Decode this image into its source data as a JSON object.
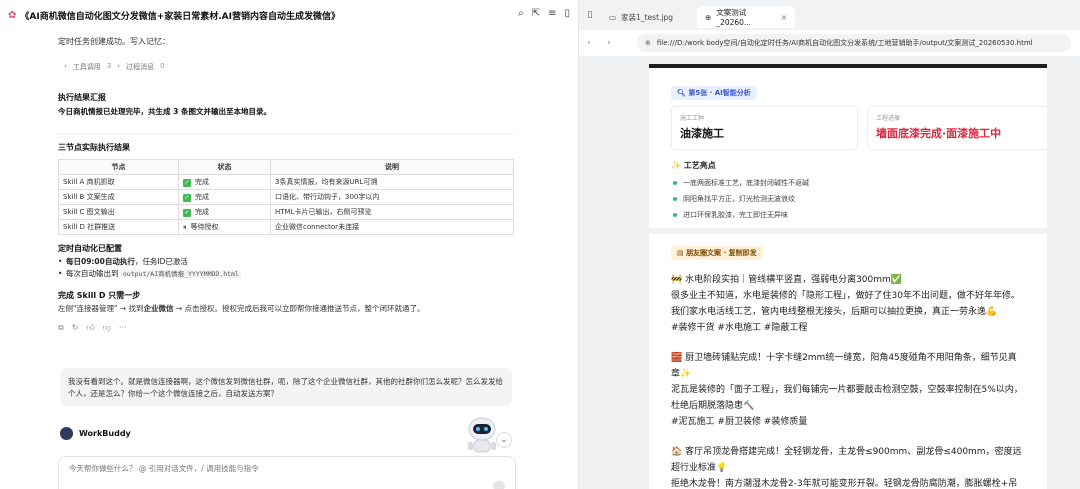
{
  "app": {
    "title": "《AI商机微信自动化图文分发微信+家装日常素材.AI营销内容自动生成发微信》",
    "tool_icons": [
      "search-icon",
      "export-icon",
      "menu-icon",
      "sidebar-icon"
    ]
  },
  "chat": {
    "intro": "定时任务创建成功。写入记忆：",
    "collapse": {
      "tools_label": "工具调用",
      "tools_count": "3",
      "process_label": "过程消息",
      "process_count": "0"
    },
    "summary_title": "执行结果汇报",
    "summary_text": "今日商机情报已处理完毕，共生成 3 条图文并输出至本地目录。",
    "table_title": "三节点实际执行结果",
    "table": {
      "headers": [
        "节点",
        "状态",
        "说明"
      ],
      "rows": [
        {
          "node": "Skill A 商机抓取",
          "status": "完成",
          "status_type": "done",
          "note": "3条真实情报，均有来源URL可溯"
        },
        {
          "node": "Skill B 文案生成",
          "status": "完成",
          "status_type": "done",
          "note": "口语化、带行动钩子，300字以内"
        },
        {
          "node": "Skill C 图文输出",
          "status": "完成",
          "status_type": "done",
          "note": "HTML卡片已输出，右侧可预览"
        },
        {
          "node": "Skill D 社群推送",
          "status": "等待授权",
          "status_type": "waiting",
          "note": "企业微信connector未连接"
        }
      ]
    },
    "auto_title": "定时自动化已配置",
    "auto_items": [
      {
        "bold": "每日09:00自动执行",
        "rest": "，任务ID已激活"
      },
      {
        "prefix": "每次自动输出到 ",
        "code": "output/AI商机情报_YYYYMMDD.html"
      }
    ],
    "final_title": "完成 Skill D 只需一步",
    "final_prefix": "左侧\"连接器管理\" → 找到",
    "final_bold": "企业微信",
    "final_suffix": " → 点击授权。授权完成后我可以立即帮你接通推送节点，整个闭环就通了。",
    "user_message": "我没有看到这个。就是微信连接器啊，这个微信发到微信社群，呃，除了这个企业微信社群，其他的社群你们怎么发呢？怎么发发给个人，还是怎么？你给一个这个微信连接之后，自动发送方案？",
    "assistant_name": "WorkBuddy",
    "composer_placeholder": "今天帮你做些什么？ @ 引用对话文件，/ 调用技能与指令"
  },
  "browser": {
    "tabs": [
      {
        "label": "家装1_test.jpg",
        "active": false
      },
      {
        "label": "文案测试_20260...",
        "active": true
      }
    ],
    "url": "file:///D:/work body空间/自动化定时任务/AI商机自动化图文分发系统/工地营销助手/output/文案测试_20260530.html",
    "page": {
      "card1_pill": "第5张 · AI智能分析",
      "box1_label": "施工工种",
      "box1_value": "油漆施工",
      "box2_label": "工程进展",
      "box2_value": "墙面底漆完成·面漆施工中",
      "highlights_title": "工艺亮点",
      "highlights": [
        "一底两面标准工艺，底漆封闭碱性不返碱",
        "阴阳角找平方正，灯光检测无波浪纹",
        "进口环保乳胶漆，完工即住无异味"
      ],
      "card2_pill": "朋友圈文案 · 复制即发",
      "post1": [
        "🚧 水电阶段实拍｜管线横平竖直，强弱电分离300mm✅",
        "很多业主不知道，水电是装修的「隐形工程」，做好了住30年不出问题，做不好年年修。我们家水电活线工艺，管内电线整根无接头，后期可以抽拉更换，真正一劳永逸💪",
        "#装修干货 #水电施工 #隐蔽工程"
      ],
      "post2": [
        "🧱 厨卫墙砖铺贴完成！十字卡缝2mm统一缝宽，阳角45度碰角不用阳角条，细节见真章✨",
        "泥瓦是装修的「面子工程」，我们每铺完一片都要敲击检测空鼓，空鼓率控制在5%以内，杜绝后期脱落隐患🔨",
        "#泥瓦施工 #厨卫装修 #装修质量"
      ],
      "post3": [
        "🏠 客厅吊顶龙骨搭建完成！全轻钢龙骨，主龙骨≤900mm、副龙骨≤400mm，密度远超行业标准💡",
        "拒绝木龙骨！南方潮湿木龙骨2-3年就可能变形开裂。轻钢龙骨防腐防潮，膨胀螺栓+吊杆双保"
      ]
    }
  },
  "colors": {
    "accent_red": "#d9263c",
    "check_green": "#3fb950",
    "bullet_teal": "#2db4a0",
    "pill_blue": "#3956c6"
  }
}
